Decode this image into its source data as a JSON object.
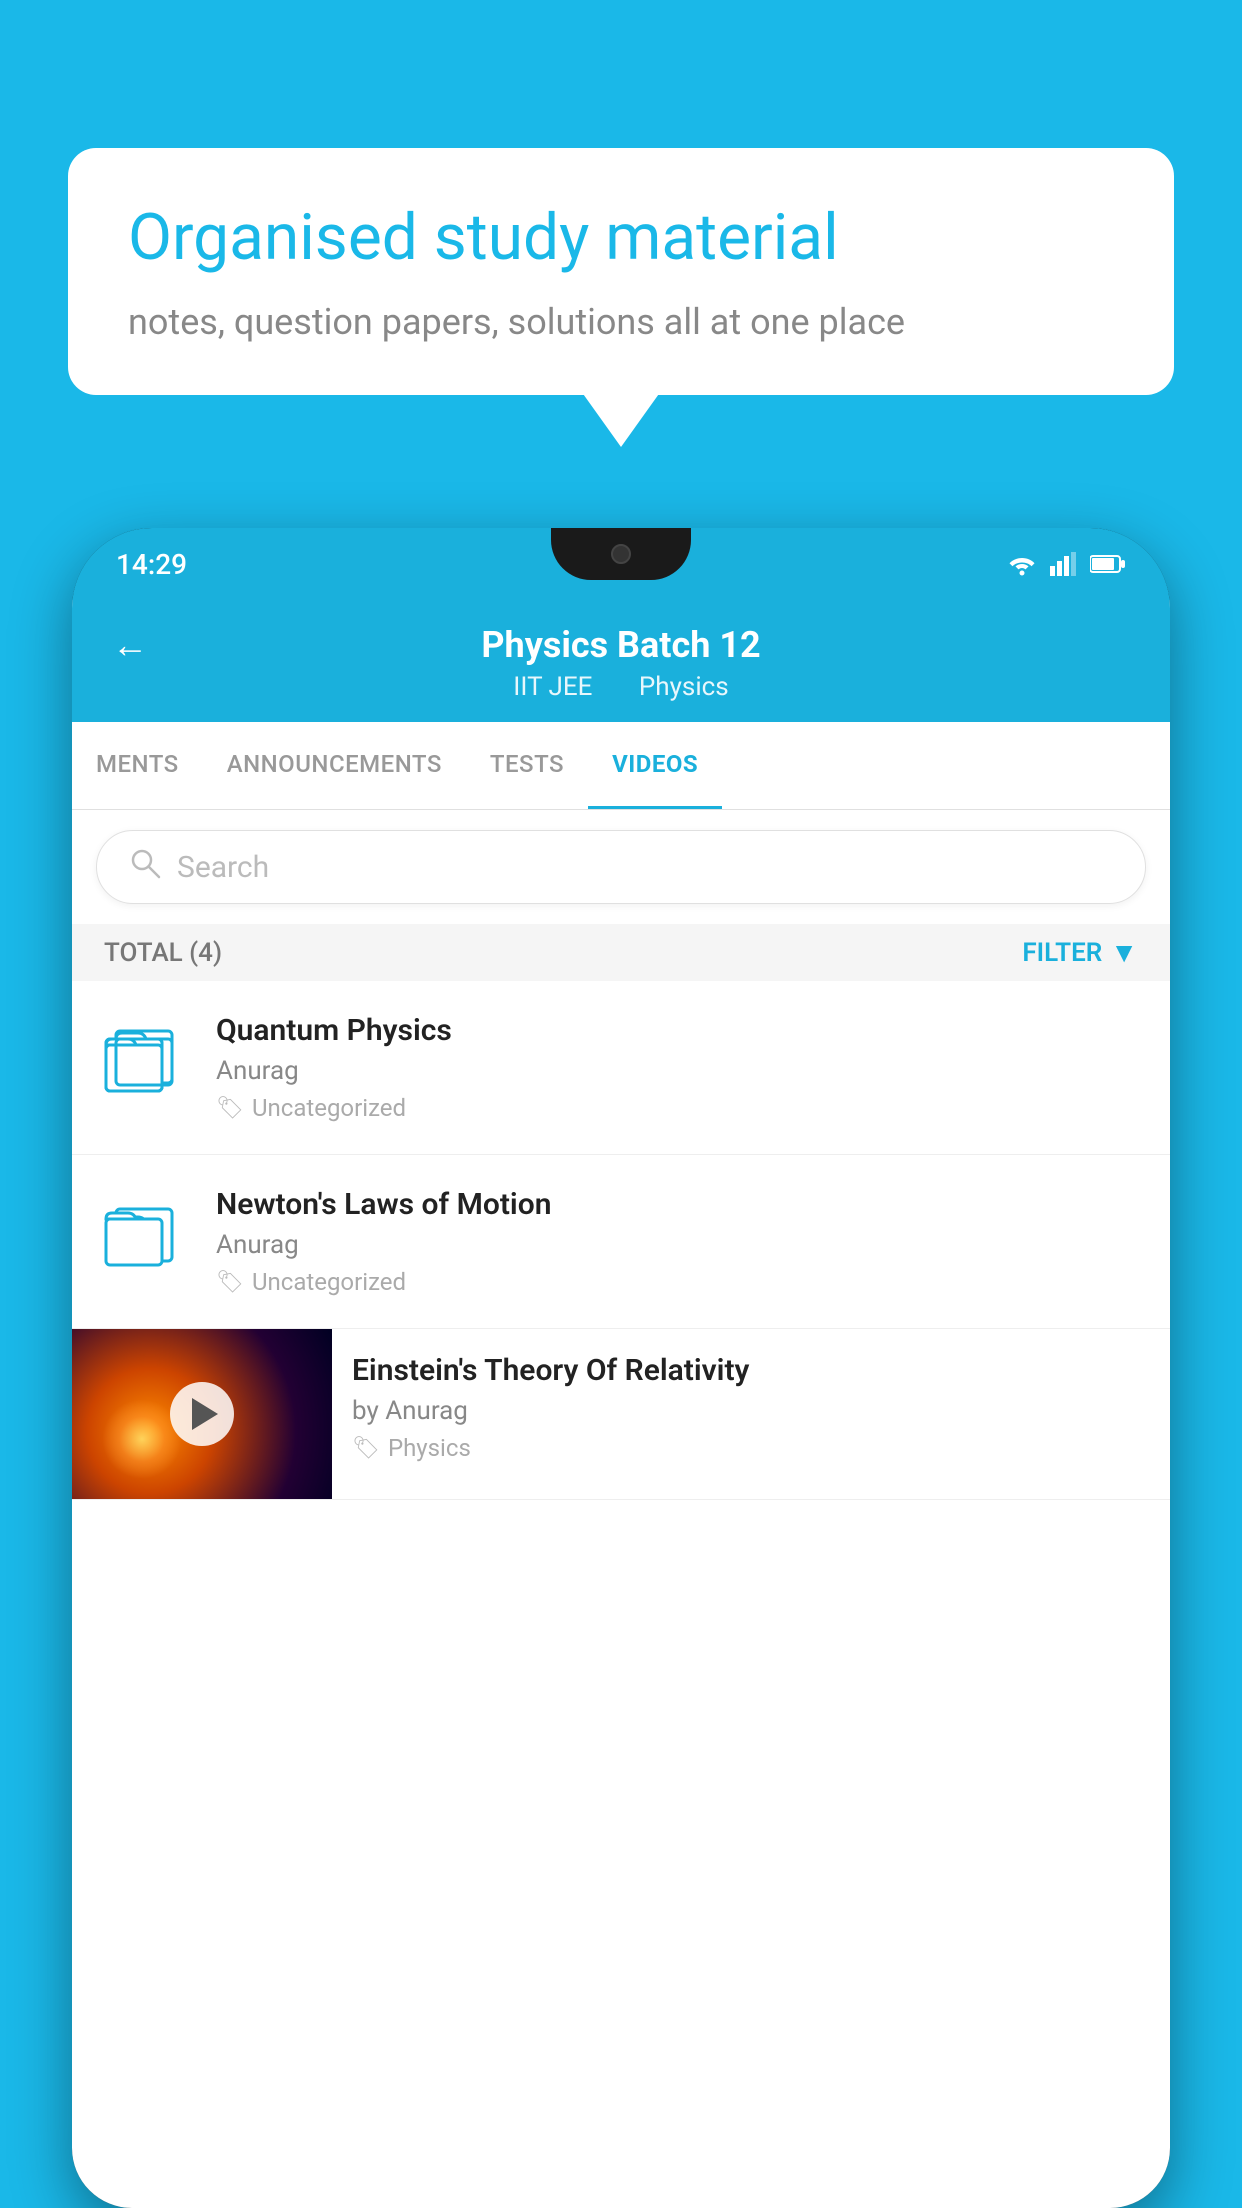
{
  "background_color": "#1ab8e8",
  "speech_bubble": {
    "title": "Organised study material",
    "subtitle": "notes, question papers, solutions all at one place"
  },
  "phone": {
    "status_bar": {
      "time": "14:29",
      "icons": [
        "wifi",
        "signal",
        "battery"
      ]
    },
    "header": {
      "back_label": "←",
      "title": "Physics Batch 12",
      "subtitle_tags": [
        "IIT JEE",
        "Physics"
      ]
    },
    "tabs": [
      {
        "label": "MENTS",
        "active": false
      },
      {
        "label": "ANNOUNCEMENTS",
        "active": false
      },
      {
        "label": "TESTS",
        "active": false
      },
      {
        "label": "VIDEOS",
        "active": true
      }
    ],
    "search": {
      "placeholder": "Search"
    },
    "filter_row": {
      "total_label": "TOTAL (4)",
      "filter_label": "FILTER"
    },
    "videos": [
      {
        "id": 1,
        "title": "Quantum Physics",
        "author": "Anurag",
        "tag": "Uncategorized",
        "has_thumbnail": false
      },
      {
        "id": 2,
        "title": "Newton's Laws of Motion",
        "author": "Anurag",
        "tag": "Uncategorized",
        "has_thumbnail": false
      },
      {
        "id": 3,
        "title": "Einstein's Theory Of Relativity",
        "author": "by Anurag",
        "tag": "Physics",
        "has_thumbnail": true
      }
    ]
  }
}
